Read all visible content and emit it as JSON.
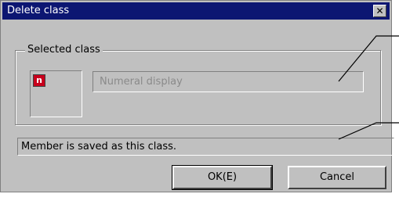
{
  "window": {
    "title": "Delete class",
    "close_label": "✕"
  },
  "group": {
    "label": "Selected class"
  },
  "selected_class": {
    "icon_glyph": "n",
    "icon_color": "#c8001c",
    "name": "Numeral display"
  },
  "status": {
    "message": "Member is saved as this class."
  },
  "buttons": {
    "ok_label": "OK(E)",
    "cancel_label": "Cancel"
  }
}
